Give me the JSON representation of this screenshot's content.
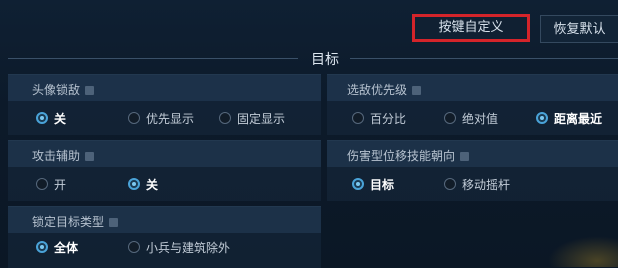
{
  "header": {
    "custom_label": "按键自定义",
    "reset_label": "恢复默认"
  },
  "section": {
    "title": "目标"
  },
  "groups": {
    "avatar_lock": {
      "label": "头像锁敌",
      "options": [
        "关",
        "优先显示",
        "固定显示"
      ],
      "selected": 0
    },
    "enemy_priority": {
      "label": "选敌优先级",
      "options": [
        "百分比",
        "绝对值",
        "距离最近"
      ],
      "selected": 2
    },
    "attack_assist": {
      "label": "攻击辅助",
      "options": [
        "开",
        "关"
      ],
      "selected": 1
    },
    "skill_direction": {
      "label": "伤害型位移技能朝向",
      "options": [
        "目标",
        "移动摇杆"
      ],
      "selected": 0
    },
    "lock_target_type": {
      "label": "锁定目标类型",
      "options": [
        "全体",
        "小兵与建筑除外"
      ],
      "selected": 0
    }
  },
  "colors": {
    "highlight_border": "#d4242a",
    "radio_active": "#4aa3d8",
    "background": "#0b1826"
  }
}
